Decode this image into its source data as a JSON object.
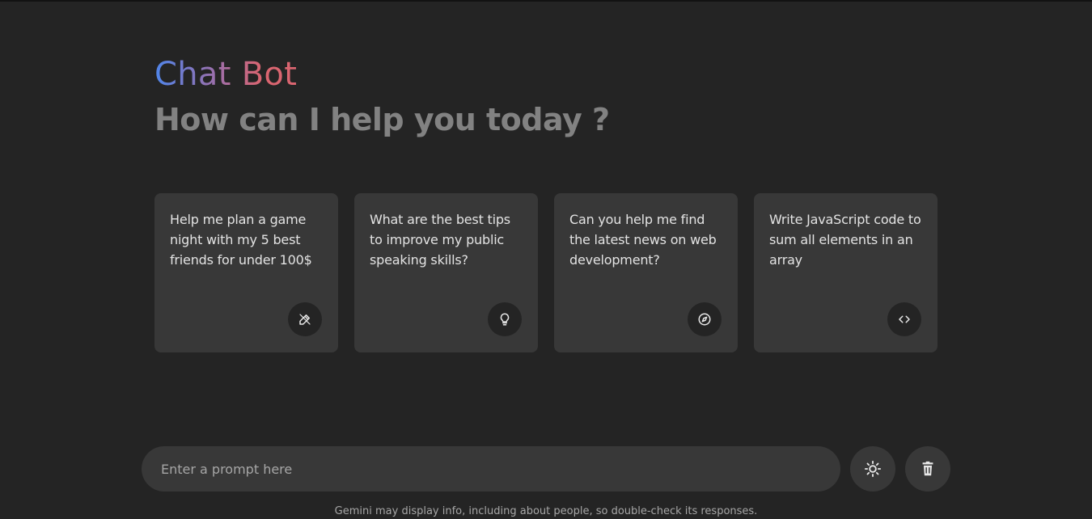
{
  "header": {
    "title": "Chat Bot",
    "subtitle": "How can I help you today ?"
  },
  "suggestions": [
    {
      "text": "Help me plan a game night with my 5 best friends for under 100$",
      "icon": "draw-icon"
    },
    {
      "text": "What are the best tips to improve my public speaking skills?",
      "icon": "lightbulb-icon"
    },
    {
      "text": "Can you help me find the latest news on web development?",
      "icon": "compass-icon"
    },
    {
      "text": "Write JavaScript code to sum all elements in an array",
      "icon": "code-icon"
    }
  ],
  "prompt": {
    "placeholder": "Enter a prompt here"
  },
  "actions": {
    "theme_icon": "sun-icon",
    "delete_icon": "trash-icon"
  },
  "footer": {
    "disclaimer": "Gemini may display info, including about people, so double-check its responses."
  },
  "colors": {
    "background": "#242424",
    "card": "#383838",
    "gradient_start": "#4f85ea",
    "gradient_end": "#d96570",
    "subtitle": "#828282"
  }
}
